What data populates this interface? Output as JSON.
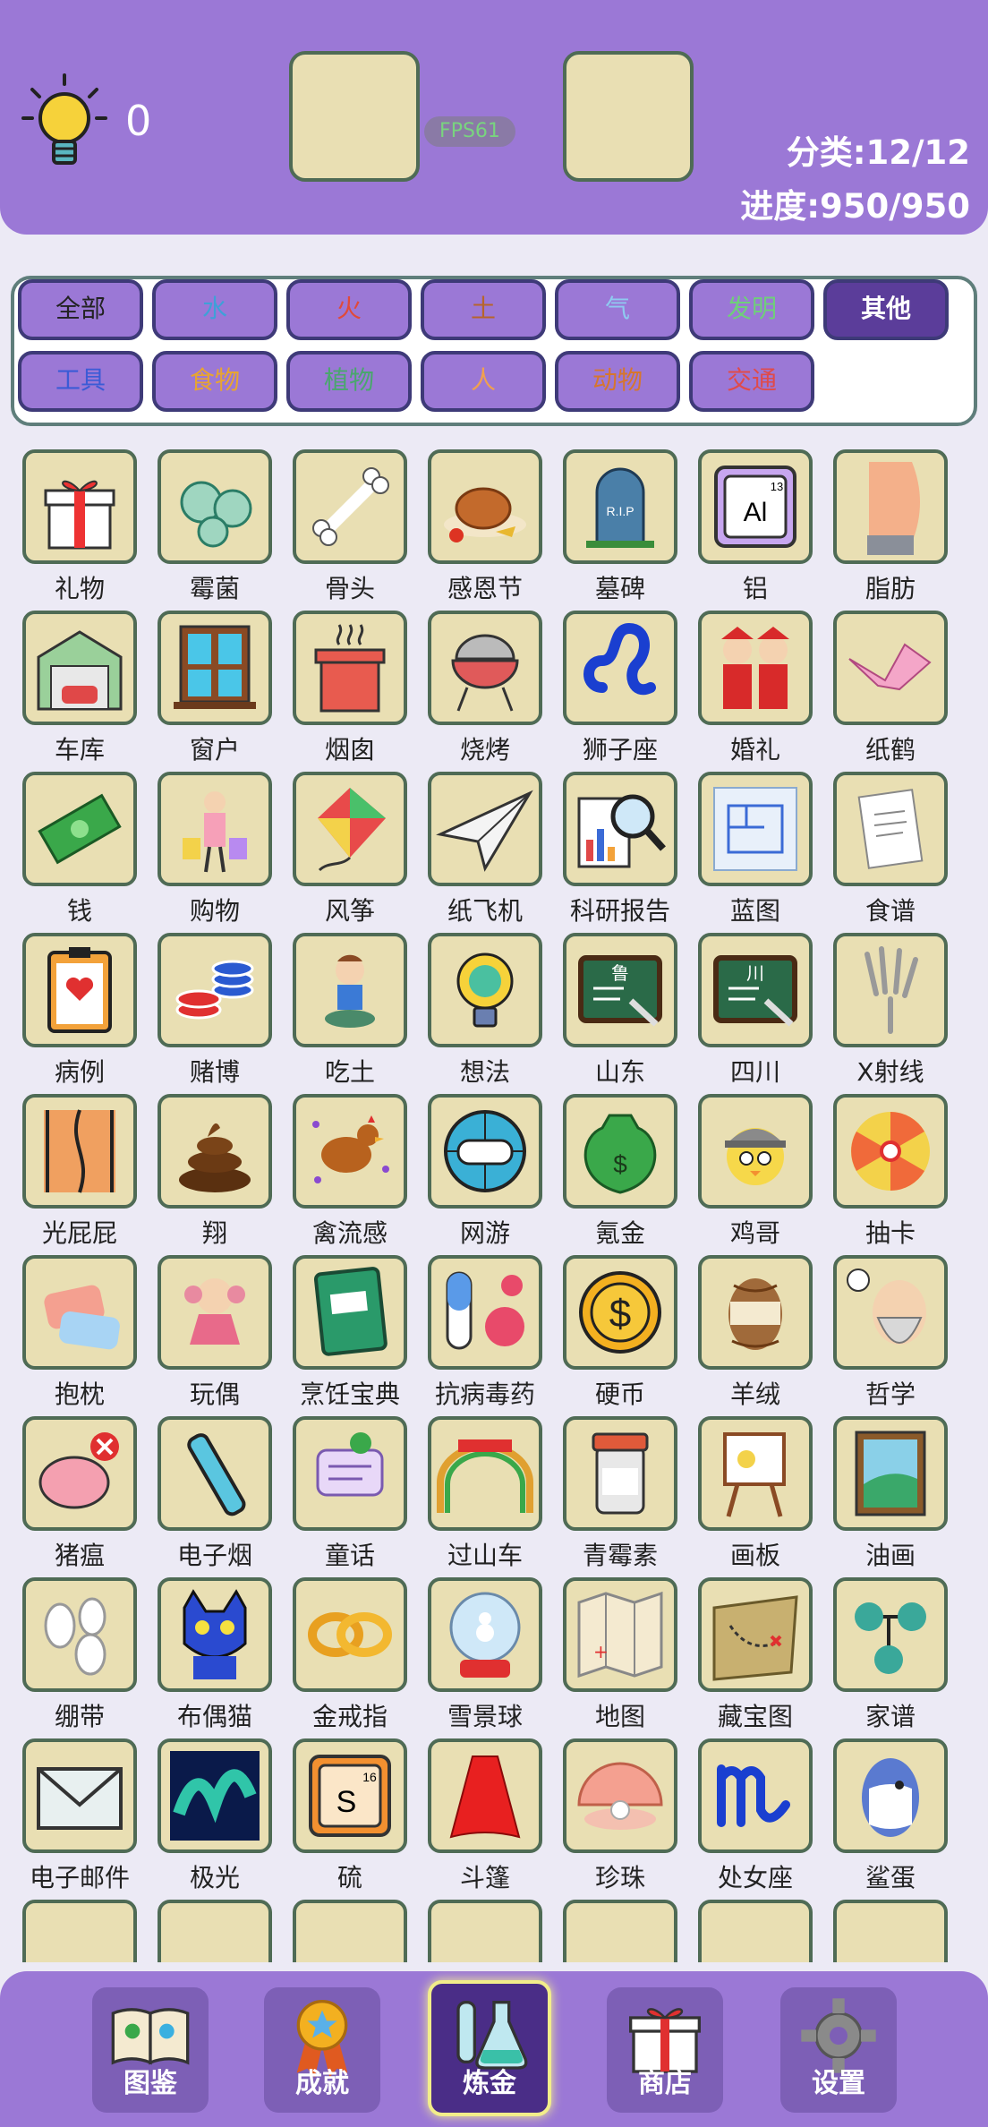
{
  "header": {
    "hint_count": "0",
    "fps": "FPS61",
    "category": "分类:12/12",
    "progress": "进度:950/950"
  },
  "filters": [
    {
      "label": "全部",
      "color": "#222222",
      "active": false
    },
    {
      "label": "水",
      "color": "#3fa0d8",
      "active": false
    },
    {
      "label": "火",
      "color": "#e04a3a",
      "active": false
    },
    {
      "label": "土",
      "color": "#b7652c",
      "active": false
    },
    {
      "label": "气",
      "color": "#8fcaf0",
      "active": false
    },
    {
      "label": "发明",
      "color": "#6fcf7a",
      "active": false
    },
    {
      "label": "其他",
      "color": "#ffffff",
      "active": true
    },
    {
      "label": "工具",
      "color": "#3b5bd6",
      "active": false
    },
    {
      "label": "食物",
      "color": "#e8a530",
      "active": false
    },
    {
      "label": "植物",
      "color": "#4aa66e",
      "active": false
    },
    {
      "label": "人",
      "color": "#f0a050",
      "active": false
    },
    {
      "label": "动物",
      "color": "#d6762e",
      "active": false
    },
    {
      "label": "交通",
      "color": "#e04a4a",
      "active": false
    }
  ],
  "items": [
    {
      "name": "礼物",
      "icon": "gift-icon"
    },
    {
      "name": "霉菌",
      "icon": "mold-icon"
    },
    {
      "name": "骨头",
      "icon": "bone-icon"
    },
    {
      "name": "感恩节",
      "icon": "turkey-icon"
    },
    {
      "name": "墓碑",
      "icon": "tombstone-icon"
    },
    {
      "name": "铝",
      "icon": "aluminum-icon"
    },
    {
      "name": "脂肪",
      "icon": "belly-icon"
    },
    {
      "name": "车库",
      "icon": "garage-icon"
    },
    {
      "name": "窗户",
      "icon": "window-icon"
    },
    {
      "name": "烟囱",
      "icon": "chimney-icon"
    },
    {
      "name": "烧烤",
      "icon": "grill-icon"
    },
    {
      "name": "狮子座",
      "icon": "leo-icon"
    },
    {
      "name": "婚礼",
      "icon": "wedding-icon"
    },
    {
      "name": "纸鹤",
      "icon": "crane-icon"
    },
    {
      "name": "钱",
      "icon": "money-icon"
    },
    {
      "name": "购物",
      "icon": "shopping-icon"
    },
    {
      "name": "风筝",
      "icon": "kite-icon"
    },
    {
      "name": "纸飞机",
      "icon": "paper-plane-icon"
    },
    {
      "name": "科研报告",
      "icon": "report-icon"
    },
    {
      "name": "蓝图",
      "icon": "blueprint-icon"
    },
    {
      "name": "食谱",
      "icon": "recipe-icon"
    },
    {
      "name": "病例",
      "icon": "medical-record-icon"
    },
    {
      "name": "赌博",
      "icon": "chips-icon"
    },
    {
      "name": "吃土",
      "icon": "sitting-boy-icon"
    },
    {
      "name": "想法",
      "icon": "idea-icon"
    },
    {
      "name": "山东",
      "icon": "chalkboard-lu-icon",
      "mark": "鲁"
    },
    {
      "name": "四川",
      "icon": "chalkboard-chuan-icon",
      "mark": "川"
    },
    {
      "name": "X射线",
      "icon": "xray-hand-icon"
    },
    {
      "name": "光屁屁",
      "icon": "butt-icon"
    },
    {
      "name": "翔",
      "icon": "poop-icon"
    },
    {
      "name": "禽流感",
      "icon": "chicken-icon"
    },
    {
      "name": "网游",
      "icon": "gamepad-globe-icon"
    },
    {
      "name": "氪金",
      "icon": "money-bag-icon"
    },
    {
      "name": "鸡哥",
      "icon": "chick-cap-icon"
    },
    {
      "name": "抽卡",
      "icon": "wheel-icon"
    },
    {
      "name": "抱枕",
      "icon": "pillow-icon"
    },
    {
      "name": "玩偶",
      "icon": "doll-icon"
    },
    {
      "name": "烹饪宝典",
      "icon": "cookbook-icon"
    },
    {
      "name": "抗病毒药",
      "icon": "pill-virus-icon"
    },
    {
      "name": "硬币",
      "icon": "coin-icon"
    },
    {
      "name": "羊绒",
      "icon": "yarn-icon"
    },
    {
      "name": "哲学",
      "icon": "philosopher-icon"
    },
    {
      "name": "猪瘟",
      "icon": "sick-pig-icon"
    },
    {
      "name": "电子烟",
      "icon": "vape-icon"
    },
    {
      "name": "童话",
      "icon": "story-bubbles-icon"
    },
    {
      "name": "过山车",
      "icon": "rollercoaster-icon"
    },
    {
      "name": "青霉素",
      "icon": "pill-bottle-icon"
    },
    {
      "name": "画板",
      "icon": "easel-icon"
    },
    {
      "name": "油画",
      "icon": "painting-icon"
    },
    {
      "name": "绷带",
      "icon": "bandage-icon"
    },
    {
      "name": "布偶猫",
      "icon": "blue-cat-icon"
    },
    {
      "name": "金戒指",
      "icon": "gold-rings-icon"
    },
    {
      "name": "雪景球",
      "icon": "snow-globe-icon"
    },
    {
      "name": "地图",
      "icon": "map-icon"
    },
    {
      "name": "藏宝图",
      "icon": "treasure-map-icon"
    },
    {
      "name": "家谱",
      "icon": "family-tree-icon"
    },
    {
      "name": "电子邮件",
      "icon": "email-icon"
    },
    {
      "name": "极光",
      "icon": "aurora-icon"
    },
    {
      "name": "硫",
      "icon": "sulfur-icon"
    },
    {
      "name": "斗篷",
      "icon": "cape-icon"
    },
    {
      "name": "珍珠",
      "icon": "pearl-shell-icon"
    },
    {
      "name": "处女座",
      "icon": "virgo-icon"
    },
    {
      "name": "鲨蛋",
      "icon": "shark-egg-icon"
    }
  ],
  "element_marks": {
    "aluminum": "Al",
    "aluminum_number": "13",
    "sulfur": "S",
    "sulfur_number": "16",
    "tombstone": "R.I.P"
  },
  "nav": [
    {
      "label": "图鉴",
      "icon": "book-icon",
      "active": false
    },
    {
      "label": "成就",
      "icon": "medal-icon",
      "active": false
    },
    {
      "label": "炼金",
      "icon": "flask-icon",
      "active": true
    },
    {
      "label": "商店",
      "icon": "gift-box-icon",
      "active": false
    },
    {
      "label": "设置",
      "icon": "gear-icon",
      "active": false
    }
  ]
}
